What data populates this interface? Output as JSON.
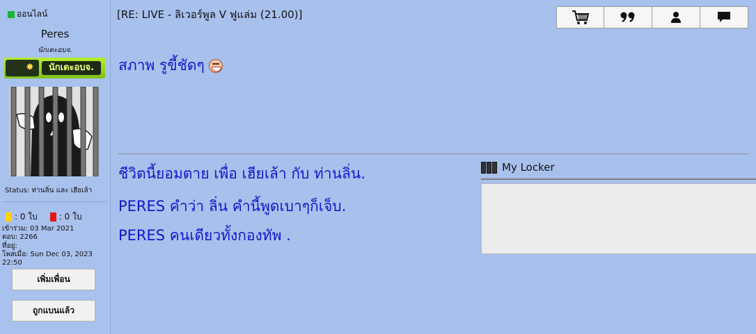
{
  "sidebar": {
    "online_label": "ออนไลน์",
    "username": "Peres",
    "rank_title": "นักเตะอบจ.",
    "rank_badge_label": "นักเตะอบจ.",
    "status_text": "Status: ท่านลิ่น และ เฮียเล้า",
    "cards": {
      "yellow_text": ": 0 ใบ",
      "red_text": ": 0 ใบ"
    },
    "joined": "เข้าร่วม: 03 Mar 2021",
    "replies": "ตอบ: 2266",
    "location": "ที่อยู่:",
    "posted": "โพสเมื่อ: Sun Dec 03, 2023 22:50",
    "add_friend_label": "เพิ่มเพื่อน",
    "banned_label": "ถูกแบนแล้ว"
  },
  "post": {
    "title": "[RE: LIVE - ลิเวอร์พูล V ฟูแล่ม (21.00)]",
    "body": "สภาพ รูขี้ชัดๆ"
  },
  "toolbar": {
    "icons": [
      "cart-icon",
      "quote-icon",
      "user-icon",
      "message-icon"
    ]
  },
  "signature": {
    "lines": [
      "ชีวิตนี้ยอมตาย เพื่อ เฮียเล้า กับ ท่านลิ่น.",
      "PERES คำว่า ลิ่น คำนี้พูดเบาๆก็เจ็บ.",
      "PERES คนเดียวทั้งกองทัพ ."
    ]
  },
  "locker": {
    "title": "My Locker"
  },
  "colors": {
    "background": "#a8c0ec",
    "post_text": "#1515c8",
    "online": "#18b43c"
  }
}
